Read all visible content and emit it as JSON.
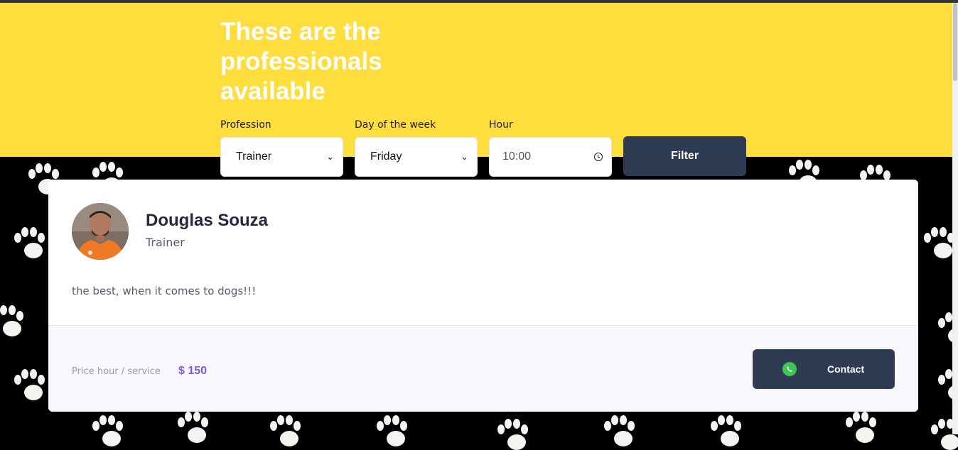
{
  "hero": {
    "title": "These are the professionals available"
  },
  "filters": {
    "profession": {
      "label": "Profession",
      "value": "Trainer"
    },
    "day": {
      "label": "Day of the week",
      "value": "Friday"
    },
    "hour": {
      "label": "Hour",
      "value": "10:00"
    },
    "filter_label": "Filter"
  },
  "professional": {
    "name": "Douglas Souza",
    "profession": "Trainer",
    "bio": "the best, when it comes to dogs!!!",
    "price_label": "Price hour / service",
    "price_value": "$ 150",
    "contact_label": "Contact"
  },
  "colors": {
    "hero_bg": "#FFDD3C",
    "button_bg": "#2E3B52",
    "price": "#8257E5",
    "whatsapp": "#43C553"
  },
  "icons": [
    "whatsapp-icon",
    "clock-icon",
    "chevron-down-icon",
    "paw-print-icon"
  ]
}
